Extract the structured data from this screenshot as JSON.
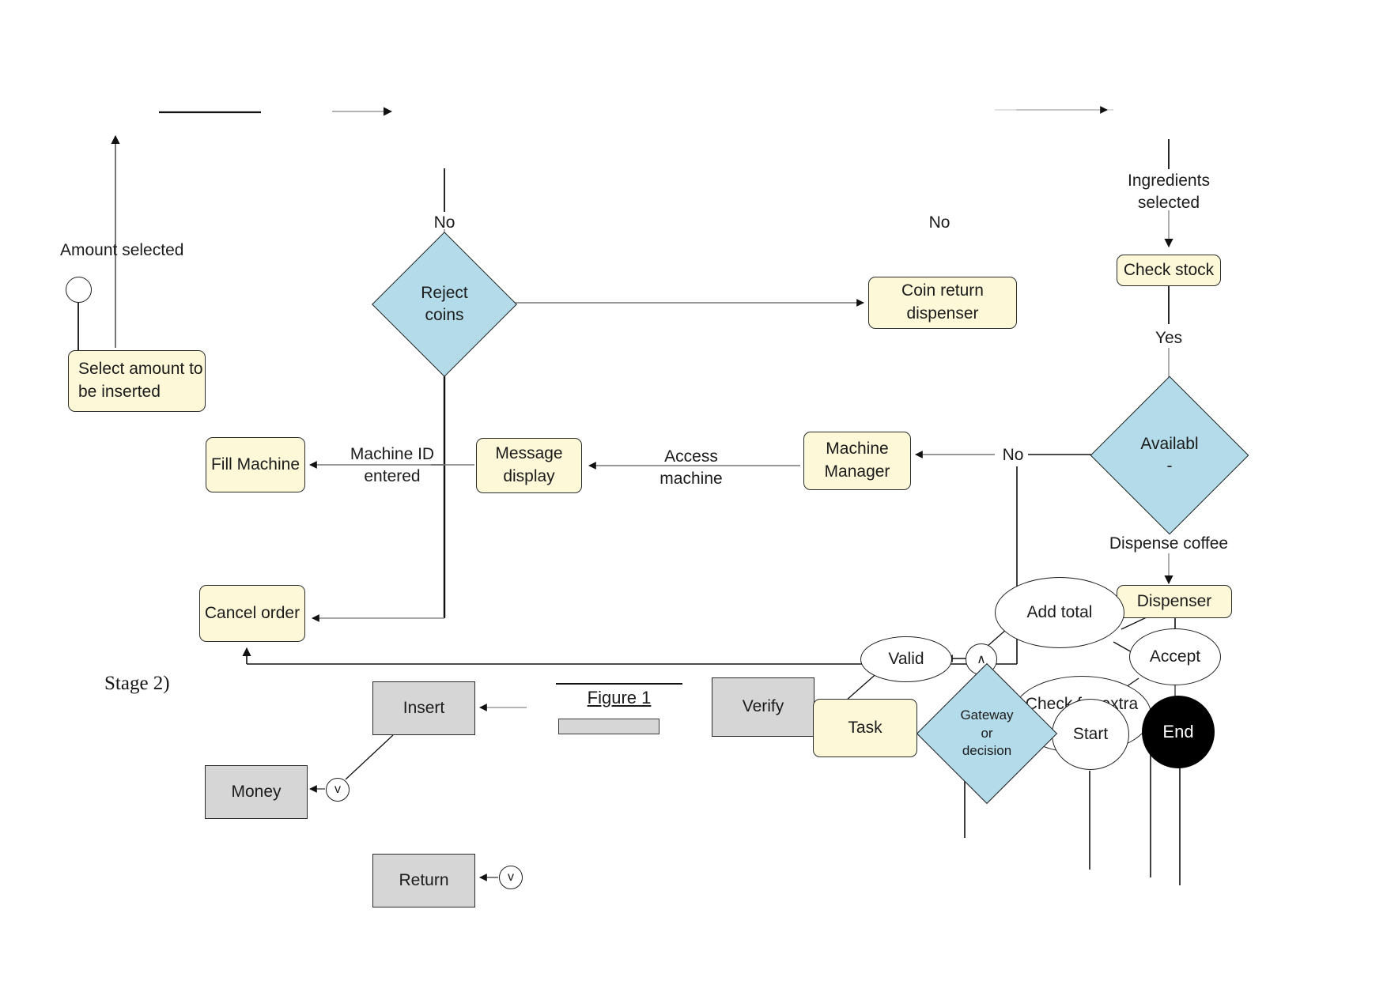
{
  "diagram": {
    "title_caption": "Figure 1",
    "stage_label": "Stage 2)",
    "colors": {
      "action_fill": "#fcf8d8",
      "decision_fill": "#b3dbe9",
      "legend_fill": "#d6d6d6",
      "stroke": "#1f1f1f",
      "end_fill": "#000000"
    }
  },
  "nodes": {
    "initial": "",
    "select_amount": "Select amount to\nbe inserted",
    "reject_coins": "Reject\ncoins",
    "coin_return": "Coin return\ndispenser",
    "check_stock": "Check stock",
    "available": "Availabl\n-",
    "fill_machine": "Fill Machine",
    "message_display": "Message\ndisplay",
    "machine_manager": "Machine\nManager",
    "cancel_order": "Cancel order",
    "dispenser": "Dispenser",
    "add_total": "Add total",
    "valid": "Valid",
    "accept": "Accept",
    "check_extra": "Check for extra\namount",
    "start": "Start",
    "end": "End",
    "join_node": "∧",
    "legend_task": "Task",
    "legend_gateway": "Gateway\nor\ndecision",
    "legend_verify": "Verify",
    "legend_insert": "Insert",
    "legend_money": "Money",
    "legend_return": "Return",
    "legend_fork_v": "v",
    "legend_fork_v2": "v"
  },
  "edge_labels": {
    "amount_selected": "Amount selected",
    "no_reject": "No",
    "no_coin_return": "No",
    "ingredients_selected": "Ingredients\nselected",
    "yes_stock": "Yes",
    "no_available": "No",
    "dispense_coffee": "Dispense coffee",
    "machine_id_entered": "Machine ID\nentered",
    "access_machine": "Access\nmachine"
  }
}
